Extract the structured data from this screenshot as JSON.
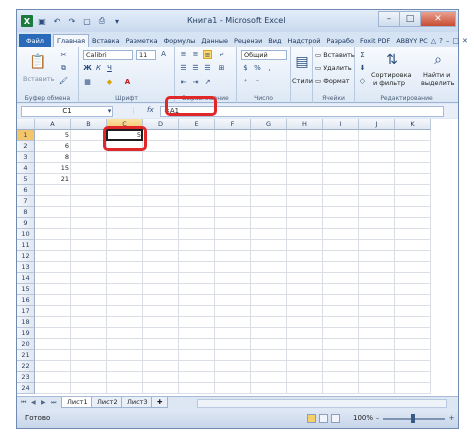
{
  "title": "Книга1 - Microsoft Excel",
  "window_buttons": {
    "minimize": "–",
    "maximize": "□",
    "close": "✕"
  },
  "tabs": [
    "Файл",
    "Главная",
    "Вставка",
    "Разметка",
    "Формулы",
    "Данные",
    "Рецензи",
    "Вид",
    "Надстрой",
    "Разрабо",
    "Foxit PDF",
    "ABBYY PC"
  ],
  "active_tab": "Главная",
  "ribbon": {
    "paste_label": "Вставить",
    "clipboard_label": "Буфер обмена",
    "font_name": "Calibri",
    "font_size": "11",
    "font_group_label": "Шрифт",
    "align_group_label": "Выравнивание",
    "number_format": "Общий",
    "number_group_label": "Число",
    "styles_label": "Стили",
    "insert_label": "Вставить",
    "delete_label": "Удалить",
    "format_label": "Формат",
    "cells_group_label": "Ячейки",
    "sort_label": "Сортировка",
    "sort_label2": "и фильтр",
    "find_label": "Найти и",
    "find_label2": "выделить",
    "editing_group_label": "Редактирование",
    "bold": "Ж",
    "italic": "К",
    "underline": "Ч"
  },
  "formula_bar": {
    "name_box": "C1",
    "fx": "fx",
    "formula": "=A1"
  },
  "columns": [
    "A",
    "B",
    "C",
    "D",
    "E",
    "F",
    "G",
    "H",
    "I",
    "J",
    "K"
  ],
  "selected_column": "C",
  "rows": [
    "1",
    "2",
    "3",
    "4",
    "5",
    "6",
    "7",
    "8",
    "9",
    "10",
    "11",
    "12",
    "13",
    "14",
    "15",
    "16",
    "17",
    "18",
    "19",
    "20",
    "21",
    "22",
    "23",
    "24"
  ],
  "selected_row": "1",
  "cells": {
    "A1": "5",
    "A2": "6",
    "A3": "8",
    "A4": "15",
    "A5": "21",
    "C1": "5"
  },
  "sheets": [
    "Лист1",
    "Лист2",
    "Лист3"
  ],
  "active_sheet": "Лист1",
  "status": {
    "ready": "Готово",
    "zoom": "100%"
  },
  "colors": {
    "accent": "#2a6ab8",
    "highlight_circle": "#e0272a",
    "selection_header": "#f4c66b"
  }
}
